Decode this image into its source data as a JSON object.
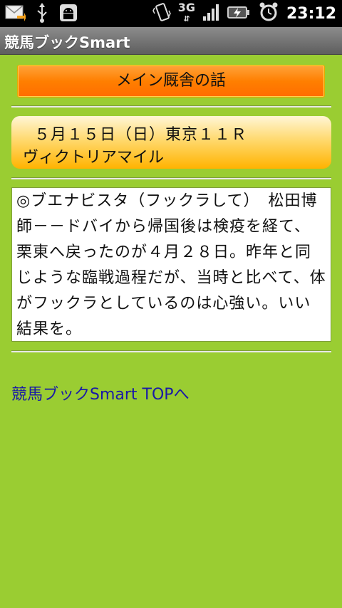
{
  "status_bar": {
    "time": "23:12",
    "network": "3G",
    "icons": [
      "mail-icon",
      "usb-icon",
      "android-icon",
      "vibrate-icon",
      "signal-icon",
      "battery-icon",
      "alarm-icon"
    ]
  },
  "app": {
    "title": "競馬ブックSmart"
  },
  "header": {
    "label": "メイン厩舎の話"
  },
  "race": {
    "line1": "５月１５日（日）東京１１Ｒ",
    "line2": "ヴィクトリアマイル"
  },
  "comment": {
    "text": "◎ブエナビスタ（フックラして）　松田博師－－ドバイから帰国後は検疫を経て、栗東へ戻ったのが４月２８日。昨年と同じような臨戦過程だが、当時と比べて、体がフックラとしているのは心強い。いい結果を。"
  },
  "footer": {
    "top_link": "競馬ブックSmart TOPへ"
  },
  "colors": {
    "background": "#9acd32",
    "header_orange": "#ff7f00",
    "race_gold": "#ffc52e",
    "link": "#1a1aa6"
  }
}
